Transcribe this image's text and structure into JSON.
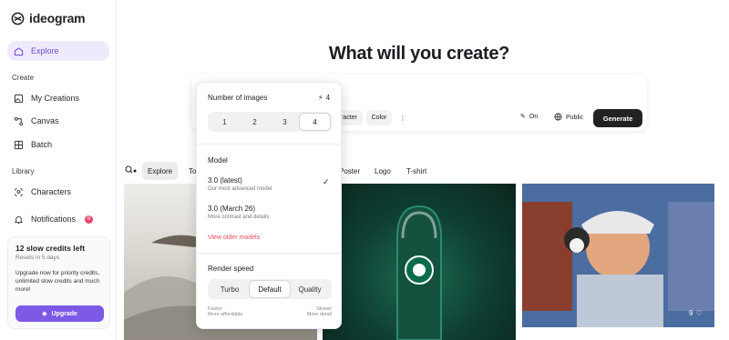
{
  "brand": {
    "name": "ideogram"
  },
  "sidebar": {
    "explore": "Explore",
    "create_section": "Create",
    "create_items": [
      "My Creations",
      "Canvas",
      "Batch"
    ],
    "library_section": "Library",
    "library_items": [
      "Characters",
      "Notifications"
    ],
    "notification_count": "6",
    "credits": {
      "title": "12 slow credits left",
      "reset": "Resets in 5 days",
      "promo": "Upgrade now for priority credits, unlimited slow credits and much more!",
      "upgrade_label": "Upgrade"
    }
  },
  "main": {
    "title": "What will you create?",
    "chips": [
      "racter",
      "Color"
    ],
    "magic_prompt_label": "On",
    "visibility_label": "Public",
    "generate_label": "Generate",
    "filters": [
      "Explore",
      "To",
      "Poster",
      "Logo",
      "T-shirt"
    ],
    "likes": "9"
  },
  "dropdown": {
    "images_label": "Number of images",
    "images_cost": "4",
    "images_options": [
      "1",
      "2",
      "3",
      "4"
    ],
    "selected_images": "4",
    "model_label": "Model",
    "models": [
      {
        "name": "3.0 (latest)",
        "desc": "Our most advanced model",
        "selected": true
      },
      {
        "name": "3.0 (March 26)",
        "desc": "More contrast and details",
        "selected": false
      }
    ],
    "older_models_label": "View older models",
    "speed_label": "Render speed",
    "speed_options": [
      "Turbo",
      "Default",
      "Quality"
    ],
    "speed_selected": "Default",
    "speed_note_left": [
      "Faster",
      "More affordable"
    ],
    "speed_note_right": [
      "Slower",
      "More detail"
    ]
  },
  "colors": {
    "accent": "#7c5ae6",
    "active_nav_bg": "#efeafb",
    "link_red": "#e2485f"
  }
}
